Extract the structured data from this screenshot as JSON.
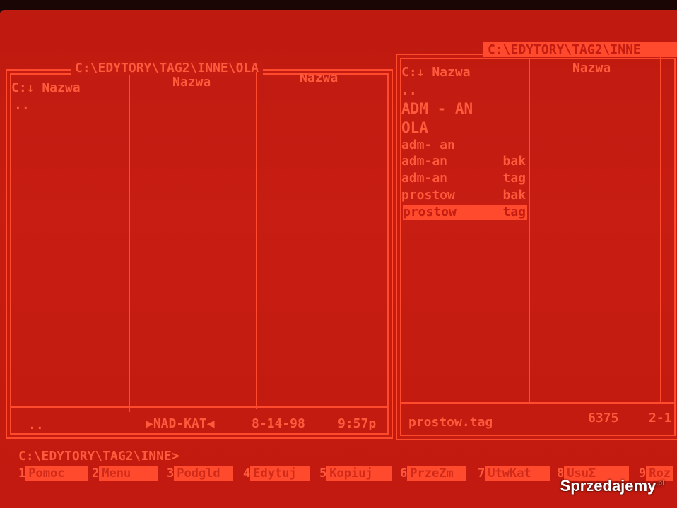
{
  "left_panel": {
    "path": "C:\\EDYTORY\\TAG2\\INNE\\OLA",
    "col1_header": "C:↓ Nazwa",
    "col2_header": "Nazwa",
    "col3_header": "Nazwa",
    "files": [
      ".."
    ],
    "status_name": "..",
    "status_type": "▶NAD-KAT◀",
    "status_date": "8-14-98",
    "status_time": "9:57p"
  },
  "right_panel": {
    "path": "C:\\EDYTORY\\TAG2\\INNE",
    "col1_header": "C:↓ Nazwa",
    "col2_header": "Nazwa",
    "files": [
      {
        "name": "..",
        "ext": ""
      },
      {
        "name": "ADM - AN",
        "ext": ""
      },
      {
        "name": "OLA",
        "ext": ""
      },
      {
        "name": "adm- an",
        "ext": ""
      },
      {
        "name": "adm-an",
        "ext": "bak"
      },
      {
        "name": "adm-an",
        "ext": "tag"
      },
      {
        "name": "prostow",
        "ext": "bak"
      },
      {
        "name": "prostow",
        "ext": "tag"
      }
    ],
    "selected_index": 7,
    "status_name": "prostow.tag",
    "status_size": "6375",
    "status_date": "2-1"
  },
  "command_line": "C:\\EDYTORY\\TAG2\\INNE>",
  "function_keys": [
    {
      "num": "1",
      "label": "Pomoc"
    },
    {
      "num": "2",
      "label": "Menu"
    },
    {
      "num": "3",
      "label": "Podgld"
    },
    {
      "num": "4",
      "label": "Edytuj"
    },
    {
      "num": "5",
      "label": "Kopiuj"
    },
    {
      "num": "6",
      "label": "PrzeZm"
    },
    {
      "num": "7",
      "label": "UtwKat"
    },
    {
      "num": "8",
      "label": "UsuΣ"
    },
    {
      "num": "9",
      "label": "Roz"
    }
  ],
  "watermark": "Sprzedajemy",
  "watermark_suffix": ".pl",
  "colors": {
    "background": "#c41c11",
    "foreground": "#ff5a3c",
    "highlight": "#ff4a2e"
  }
}
